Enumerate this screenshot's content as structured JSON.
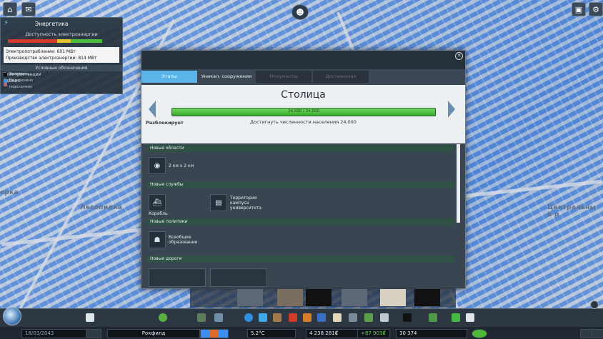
{
  "map": {
    "labels": {
      "left": "ерка",
      "lesopilka": "Лесопилка",
      "central": "Центральны й р"
    }
  },
  "energy_panel": {
    "title": "Энергетика",
    "availability_label": "Доступность электроэнергии",
    "consumption": "Электропотребление: 601 МВт",
    "production": "Производство электроэнергии: 814 МВт",
    "legend_title": "Условные обозначения",
    "legend": {
      "stations_label": "Электростанции",
      "buildings_label": "Здания",
      "active": "Активно",
      "inactive": "Неактивно",
      "connected": "Подключено",
      "not_connected": "Не подключено"
    },
    "colors": {
      "active": "#2f6fdd",
      "inactive": "#111111",
      "connected": "#3b8ff0",
      "not_connected": "#b06a6a"
    }
  },
  "dialog": {
    "tabs": [
      {
        "label": "Этапы"
      },
      {
        "label": "Уникал. сооружения"
      },
      {
        "label": "Монументы"
      },
      {
        "label": "Достижения"
      }
    ],
    "stage_title": "Столица",
    "progress_text": "24,000 / 24,000",
    "progress_fraction": 1.0,
    "unlocks_label": "Разблокирует",
    "goal_text": "Достигнуть численности населения 24,000",
    "sections": {
      "areas": "Новые области",
      "services": "Новые службы",
      "policies": "Новые политики",
      "roads": "Новые дороги"
    },
    "items": {
      "area": "2 км x 2 км",
      "ship": "Корабль",
      "campus": "Территория кампуса университета",
      "education": "Всеобщее образование"
    }
  },
  "status": {
    "date": "18/03/2043",
    "city": "Рокфилд",
    "temperature": "5.2°C",
    "money": "4 238 281₡",
    "income": "+87 903₡",
    "population": "30 374"
  }
}
